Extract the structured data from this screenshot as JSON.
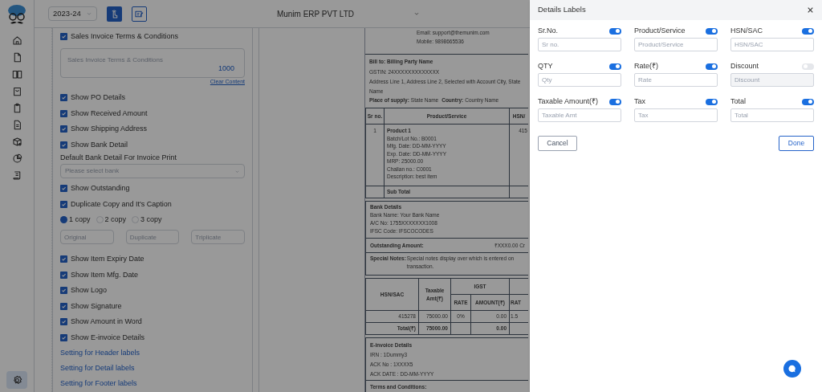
{
  "sidebar": {
    "items": [
      {
        "kind": "home",
        "selected": false
      },
      {
        "kind": "file",
        "selected": false
      },
      {
        "kind": "book",
        "selected": false
      },
      {
        "kind": "bag",
        "selected": false
      },
      {
        "kind": "clipboard",
        "selected": false
      },
      {
        "kind": "document",
        "selected": false
      },
      {
        "kind": "box",
        "selected": false
      },
      {
        "kind": "pie",
        "selected": false
      },
      {
        "kind": "scroll",
        "selected": false
      }
    ],
    "settings": {
      "selected": true
    }
  },
  "topbar": {
    "year": "2023-24",
    "company": "Munim ERP PVT LTD"
  },
  "settings": [
    {
      "kind": "checkbox",
      "label": "Sales Invoice Terms & Conditions",
      "checked": true
    },
    {
      "kind": "textarea",
      "placeholder": "Sales Invoice Terms & Conditions",
      "counter": "1000",
      "link": "Clear Content"
    },
    {
      "kind": "checkbox",
      "label": "Show PO Details",
      "checked": true
    },
    {
      "kind": "checkbox",
      "label": "Show Received Amount",
      "checked": true
    },
    {
      "kind": "checkbox",
      "label": "Show Shipping Address",
      "checked": true
    },
    {
      "kind": "checkbox",
      "label": "Show Bank Detail",
      "checked": true
    },
    {
      "kind": "select",
      "label": "Default Bank Detail For Invoice Print",
      "placeholder": "Please select bank"
    },
    {
      "kind": "checkbox",
      "label": "Show Outstanding",
      "checked": true
    },
    {
      "kind": "checkbox",
      "label": "Duplicate Copy and It's Caption",
      "checked": true
    },
    {
      "kind": "radios",
      "options": [
        {
          "label": "1 copy",
          "selected": true
        },
        {
          "label": "2 copy",
          "selected": false
        },
        {
          "label": "3 copy",
          "selected": false
        }
      ]
    },
    {
      "kind": "inputs",
      "placeholders": [
        "Original",
        "Duplicate",
        "Triplicate"
      ]
    },
    {
      "kind": "checkbox",
      "label": "Show Item Expiry Date",
      "checked": true
    },
    {
      "kind": "checkbox",
      "label": "Show Item Mfg. Date",
      "checked": true
    },
    {
      "kind": "checkbox",
      "label": "Show Logo",
      "checked": true
    },
    {
      "kind": "checkbox",
      "label": "Show Signature",
      "checked": true
    },
    {
      "kind": "checkbox",
      "label": "Show Amount in Word",
      "checked": true
    },
    {
      "kind": "checkbox",
      "label": "Show E-invoice Details",
      "checked": true
    },
    {
      "kind": "link",
      "label": "Setting for Header labels"
    },
    {
      "kind": "link",
      "label": "Setting for Detail labels"
    },
    {
      "kind": "link",
      "label": "Setting for Footer labels"
    }
  ],
  "invoice": {
    "contact": [
      "Email: support@themunim.com",
      "Mobile: 9898665536"
    ],
    "bill_to": {
      "title": "Bill to: Billing Party Name",
      "lines": [
        "GSTIN: 24XXXXXXXXXXXXX",
        "Address Line 1, Address Line 2, Selected with Account City, State Name"
      ],
      "place_label": "Place of supply:",
      "place": "State Name",
      "country_label": "Country:",
      "country": "Country Name"
    },
    "columns": [
      "Sr no.",
      "Product/Service",
      "HSN/"
    ],
    "item": {
      "sr": "1",
      "name": "Product 1",
      "lines": [
        "Batch/Lot No.: B0001",
        "Mfg. Date: DD-MM-YYYY",
        "Exp. Date: DD-MM-YYYY",
        "MRP: 25000.00",
        "Challan no.: C0001",
        "Description: best item"
      ],
      "hsn": "415"
    },
    "subtotal": "Sub Total",
    "bank": {
      "title": "Bank Details",
      "lines": [
        "Bank Name: Your Bank Name",
        "A/C No: 1755XXXXXXX1008",
        "IFSC Code: IFSCOCODES"
      ]
    },
    "outstanding": {
      "label": "Outstanding Amount:",
      "value": "₹XXX0.00 Cr"
    },
    "notes": {
      "label": "Special Notes:",
      "text": "Special notes display over which is entered on transaction."
    },
    "tax": {
      "h_hsn": "HSN/SAC",
      "h_taxable": "Taxable Amt(₹)",
      "h_igst": "IGST",
      "h_rate": "RATE",
      "h_amount": "AMOUNT(₹)",
      "h_rate2": "RAT",
      "row": [
        "415278",
        "75000.00",
        "0%",
        "0.00",
        "1.5"
      ],
      "total": [
        "Total(₹)",
        "75000.00",
        "0.00"
      ]
    },
    "einvoice": {
      "title": "E-invoice Details",
      "lines": [
        "IRN : 1Dummy3",
        "ACK No : 1XXXX5",
        "ACK DATE : DD-MM-YYYY"
      ]
    },
    "terms": "Terms and Conditions:"
  },
  "drawer": {
    "title": "Details Labels",
    "fields": [
      {
        "label": "Sr.No.",
        "on": true,
        "placeholder": "Sr no."
      },
      {
        "label": "Product/Service",
        "on": true,
        "placeholder": "Product/Service"
      },
      {
        "label": "HSN/SAC",
        "on": true,
        "placeholder": "HSN/SAC"
      },
      {
        "label": "QTY",
        "on": true,
        "placeholder": "Qty"
      },
      {
        "label": "Rate(₹)",
        "on": true,
        "placeholder": "Rate"
      },
      {
        "label": "Discount",
        "on": false,
        "placeholder": "Discount"
      },
      {
        "label": "Taxable Amount(₹)",
        "on": true,
        "placeholder": "Taxable Amt"
      },
      {
        "label": "Tax",
        "on": true,
        "placeholder": "Tax"
      },
      {
        "label": "Total",
        "on": true,
        "placeholder": "Total"
      }
    ],
    "cancel": "Cancel",
    "done": "Done"
  }
}
